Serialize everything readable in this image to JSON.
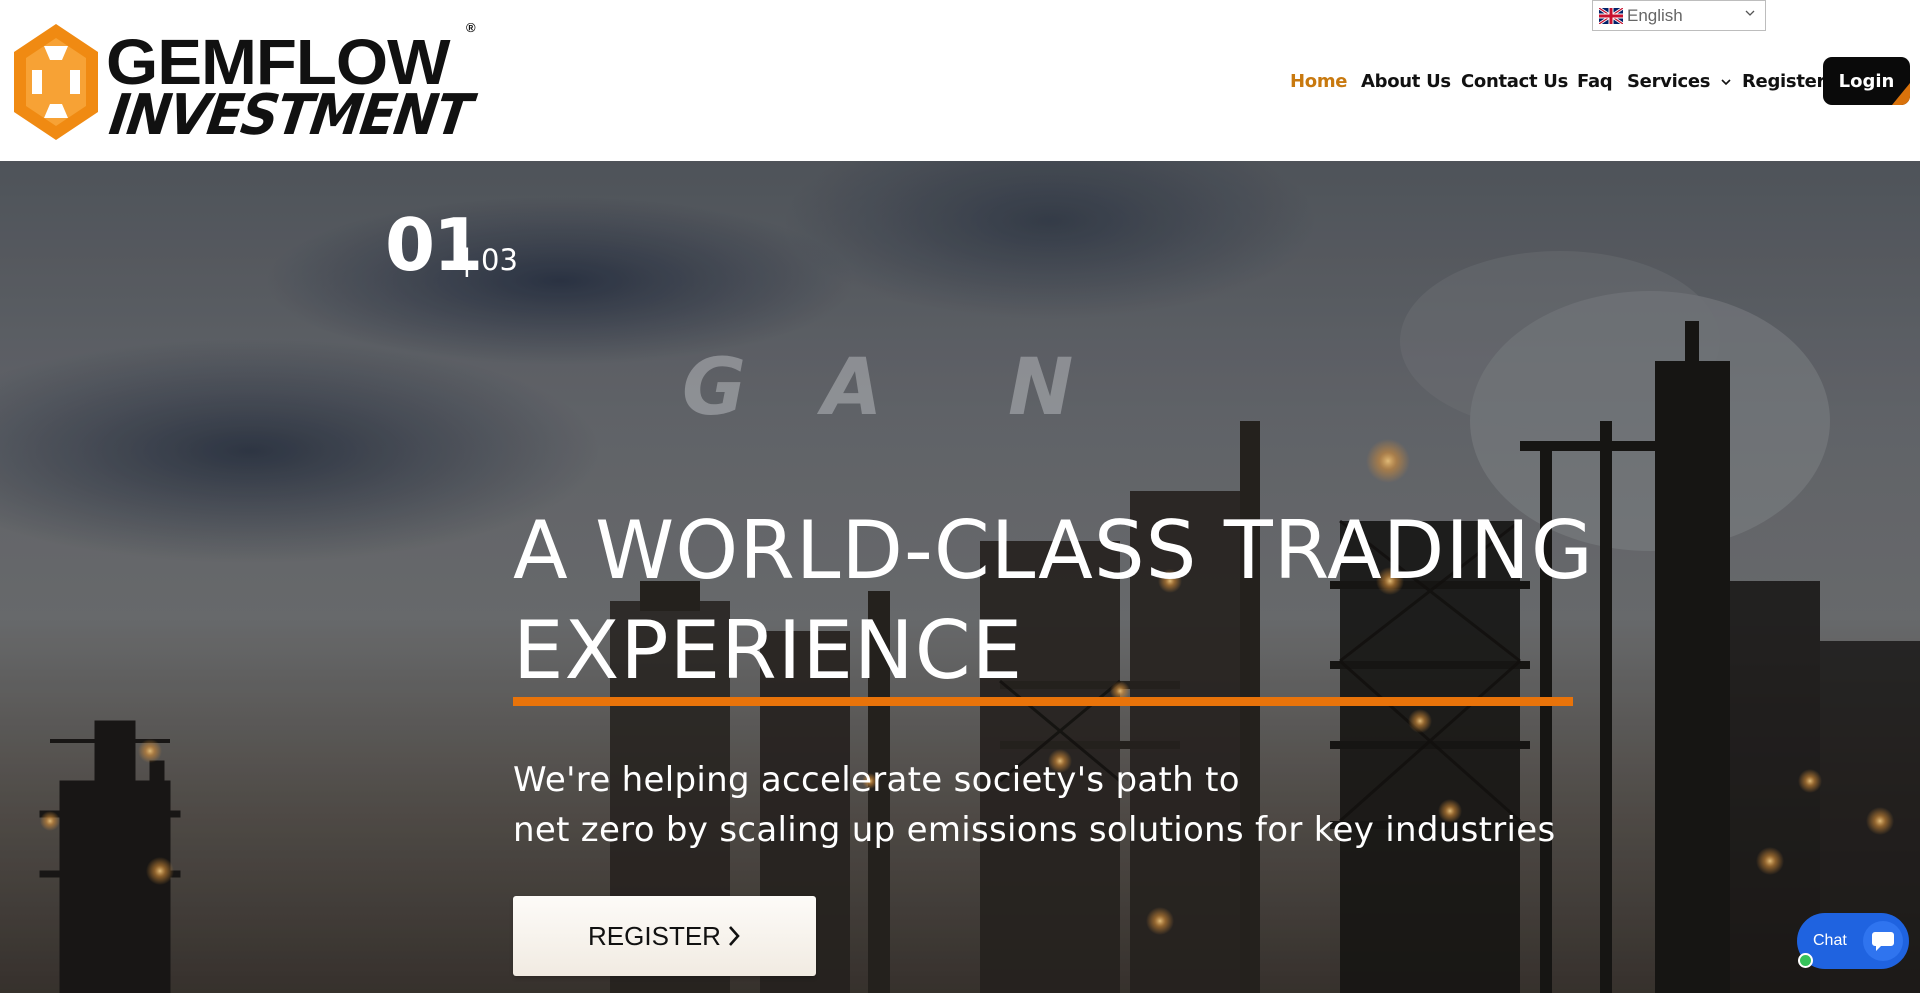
{
  "brand": {
    "name_top": "GEMFLOW",
    "name_bottom": "INVESTMENT",
    "registered": "®",
    "logo_color": "#f08a12"
  },
  "language": {
    "selected": "English",
    "flag": "uk-flag-icon"
  },
  "nav": {
    "items": [
      {
        "label": "Home",
        "active": true
      },
      {
        "label": "About Us"
      },
      {
        "label": "Contact Us"
      },
      {
        "label": "Faq"
      },
      {
        "label": "Services",
        "has_dropdown": true
      },
      {
        "label": "Register"
      }
    ],
    "login_label": "Login",
    "active_color": "#c8790f"
  },
  "hero": {
    "slide_current": "01",
    "slide_total": "| 03",
    "ghost_letters": [
      "G",
      "A",
      "N"
    ],
    "headline_line1": "A WORLD-CLASS TRADING",
    "headline_line2": "EXPERIENCE",
    "subtitle_line1": "We're helping accelerate society's path to",
    "subtitle_line2": "net zero by scaling up emissions solutions for key industries",
    "cta_label": "REGISTER",
    "accent_color": "#e8730a"
  },
  "chat": {
    "label": "Chat",
    "color": "#1f63e0"
  }
}
